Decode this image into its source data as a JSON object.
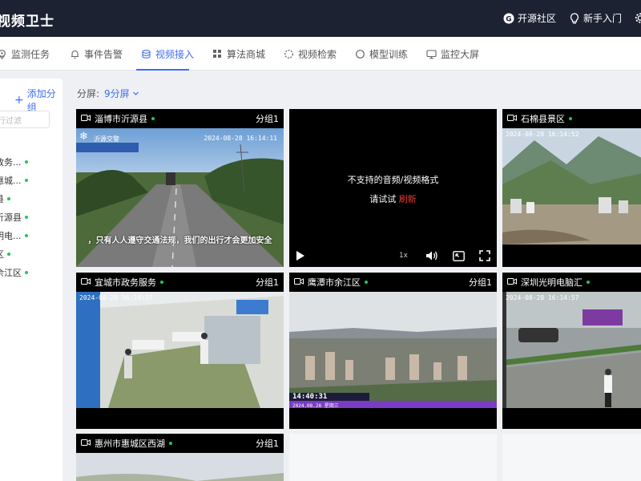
{
  "app": {
    "title": "视频卫士"
  },
  "topbar": {
    "community": "开源社区",
    "guide": "新手入门"
  },
  "tabs": [
    {
      "label": "监测任务",
      "icon": "location-pin-icon"
    },
    {
      "label": "事件告警",
      "icon": "bell-icon"
    },
    {
      "label": "视频接入",
      "icon": "database-icon",
      "active": true
    },
    {
      "label": "算法商城",
      "icon": "grid-icon"
    },
    {
      "label": "视频检索",
      "icon": "spinner-icon"
    },
    {
      "label": "模型训练",
      "icon": "circle-icon"
    },
    {
      "label": "监控大屏",
      "icon": "monitor-icon"
    }
  ],
  "sidebar": {
    "add_group": "添加分组",
    "filter_placeholder": "行过滤",
    "items": [
      {
        "label": "政务..."
      },
      {
        "label": "惠城..."
      },
      {
        "label": "县"
      },
      {
        "label": "沂源县"
      },
      {
        "label": "明电..."
      },
      {
        "label": "区"
      },
      {
        "label": "余江区"
      }
    ]
  },
  "split": {
    "label": "分屏:",
    "value": "9分屏"
  },
  "tiles": [
    {
      "name": "淄博市沂源县",
      "group": "分组1",
      "osd_left": "沂源交警",
      "osd_time": "2024-08-28 16:14:11",
      "subtitle": "，只有人人遵守交通法规，我们的出行才会更加安全"
    },
    {
      "name": "",
      "group": "",
      "error": "不支持的音频/视频格式",
      "retry_prefix": "请试试",
      "retry": "刷新",
      "speed": "1x"
    },
    {
      "name": "石棉县景区",
      "group": "",
      "osd_time": "2024-08-28 16:14:52"
    },
    {
      "name": "宜城市政务服务",
      "group": "分组1",
      "osd_time": "2024-08-28 16:14:27"
    },
    {
      "name": "鹰潭市余江区",
      "group": "分组1",
      "osd_clock": "14:40:31",
      "osd_date": "2024.08.28 星期三"
    },
    {
      "name": "深圳光明电脑汇",
      "group": "",
      "osd_time": "2024-08-28 16:14:57"
    },
    {
      "name": "惠州市惠城区西湖",
      "group": "分组1"
    }
  ],
  "colors": {
    "accent": "#3d6df2",
    "topbar": "#1d2233",
    "online": "#22c55e",
    "retry": "#e53935"
  }
}
